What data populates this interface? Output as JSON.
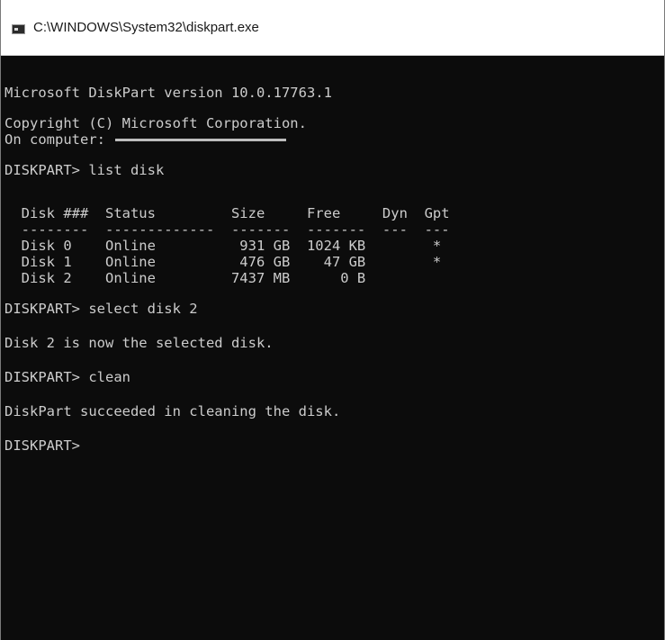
{
  "window": {
    "title": "C:\\WINDOWS\\System32\\diskpart.exe"
  },
  "console": {
    "version_line": "Microsoft DiskPart version 10.0.17763.1",
    "copyright_line": "Copyright (C) Microsoft Corporation.",
    "computer_line": "On computer: ",
    "prompt_list": "DISKPART> list disk",
    "table_header": "  Disk ###  Status         Size     Free     Dyn  Gpt",
    "table_separator": "  --------  -------------  -------  -------  ---  ---",
    "disk_rows": [
      "  Disk 0    Online          931 GB  1024 KB        *",
      "  Disk 1    Online          476 GB    47 GB        *",
      "  Disk 2    Online         7437 MB      0 B"
    ],
    "prompt_select": "DISKPART> select disk 2",
    "select_result": "Disk 2 is now the selected disk.",
    "prompt_clean": "DISKPART> clean",
    "clean_result": "DiskPart succeeded in cleaning the disk.",
    "prompt_final": "DISKPART>"
  }
}
